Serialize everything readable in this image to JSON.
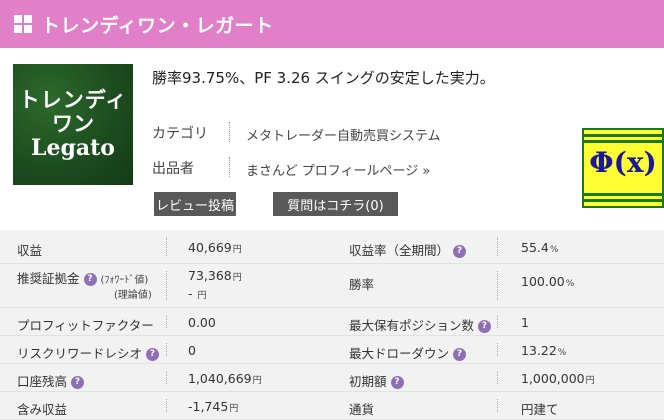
{
  "header": {
    "title": "トレンディワン・レガート"
  },
  "product_image": {
    "line1": "トレンディ",
    "line2": "ワン",
    "line3": "Legato"
  },
  "tagline": "勝率93.75%、PF 3.26 スイングの安定した実力。",
  "meta": {
    "category_label": "カテゴリ",
    "category_value": "メタトレーダー自動売買システム",
    "seller_label": "出品者",
    "seller_value": "まさんど プロフィールページ »"
  },
  "buttons": {
    "review": "レビュー投稿",
    "question": "質問はコチラ(0)"
  },
  "logo": {
    "symbol": "Φ(x)"
  },
  "stats": {
    "profit_label": "収益",
    "profit_value": "40,669",
    "profit_unit": "円",
    "profit_rate_label": "収益率（全期間）",
    "profit_rate_value": "55.4",
    "profit_rate_unit": "%",
    "margin_label": "推奨証拠金",
    "margin_forward_note": "(ﾌｫﾜｰﾄﾞ値)",
    "margin_theory_note": "(理論値)",
    "margin_forward_value": "73,368",
    "margin_forward_unit": "円",
    "margin_theory_value": "-",
    "margin_theory_unit": "円",
    "win_rate_label": "勝率",
    "win_rate_value": "100.00",
    "win_rate_unit": "%",
    "pf_label": "プロフィットファクター",
    "pf_value": "0.00",
    "max_positions_label": "最大保有ポジション数",
    "max_positions_value": "1",
    "rr_label": "リスクリワードレシオ",
    "rr_value": "0",
    "max_dd_label": "最大ドローダウン",
    "max_dd_value": "13.22",
    "max_dd_unit": "%",
    "balance_label": "口座残高",
    "balance_value": "1,040,669",
    "balance_unit": "円",
    "initial_label": "初期額",
    "initial_value": "1,000,000",
    "initial_unit": "円",
    "unrealized_label": "含み収益",
    "unrealized_value": "-1,745",
    "unrealized_unit": "円",
    "currency_label": "通貨",
    "currency_value": "円建て",
    "help_glyph": "?"
  }
}
